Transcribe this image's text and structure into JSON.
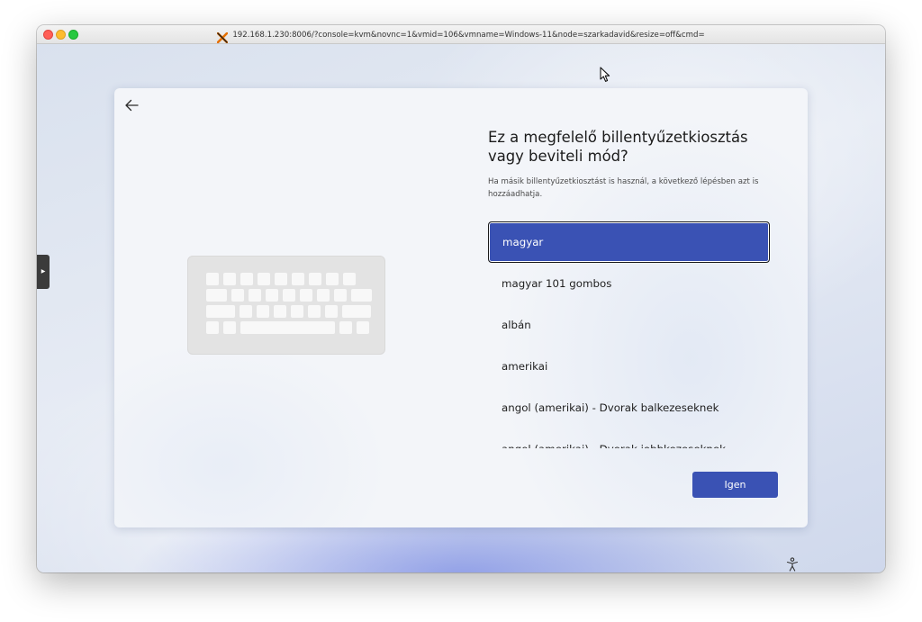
{
  "window": {
    "title": "192.168.1.230:8006/?console=kvm&novnc=1&vmid=106&vmname=Windows-11&node=szarkadavid&resize=off&cmd="
  },
  "icons": {
    "app": "proxmox-icon",
    "back": "back-arrow-icon",
    "cursor": "mouse-pointer-icon",
    "accessibility": "accessibility-icon",
    "keyboard": "keyboard-illustration",
    "side_tab": "novnc-panel-toggle-icon"
  },
  "setup": {
    "heading": "Ez a megfelelő billentyűzetkiosztás vagy beviteli mód?",
    "subtext": "Ha másik billentyűzetkiosztást is használ, a következő lépésben azt is hozzáadhatja.",
    "layouts": [
      {
        "label": "magyar",
        "selected": true
      },
      {
        "label": "magyar 101 gombos",
        "selected": false
      },
      {
        "label": "albán",
        "selected": false
      },
      {
        "label": "amerikai",
        "selected": false
      },
      {
        "label": "angol (amerikai) - Dvorak balkezeseknek",
        "selected": false
      },
      {
        "label": "angol (amerikai) - Dvorak jobbkezeseknek",
        "selected": false
      }
    ],
    "confirm_label": "Igen"
  },
  "colors": {
    "accent": "#3a52b4",
    "selected_text": "#ffffff"
  }
}
